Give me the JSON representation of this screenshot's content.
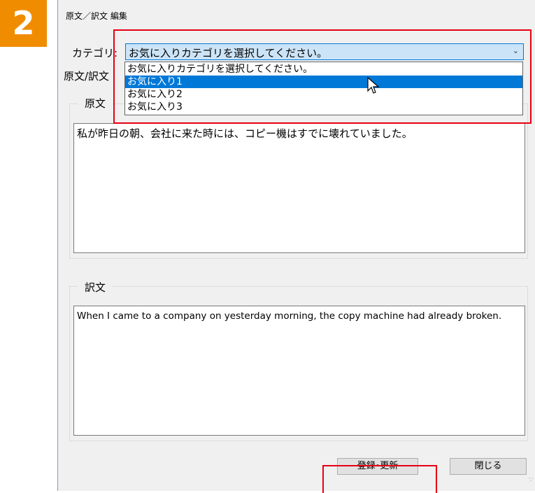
{
  "step": "2",
  "window": {
    "title": "原文／訳文 編集"
  },
  "category": {
    "label": "カテゴリ:",
    "selected": "お気に入りカテゴリを選択してください。",
    "options": [
      "お気に入りカテゴリを選択してください。",
      "お気に入り1",
      "お気に入り2",
      "お気に入り3"
    ],
    "highlighted_index": 1
  },
  "pair_label": "原文/訳文",
  "source": {
    "group_title": "原文",
    "text": "私が昨日の朝、会社に来た時には、コピー機はすでに壊れていました。"
  },
  "translation": {
    "group_title": "訳文",
    "text": "When I came to a company on yesterday morning, the copy machine had already broken."
  },
  "buttons": {
    "register": "登録･更新",
    "close": "閉じる"
  },
  "colors": {
    "badge": "#f08c00",
    "highlight": "#e60012",
    "selection": "#0078d7"
  }
}
